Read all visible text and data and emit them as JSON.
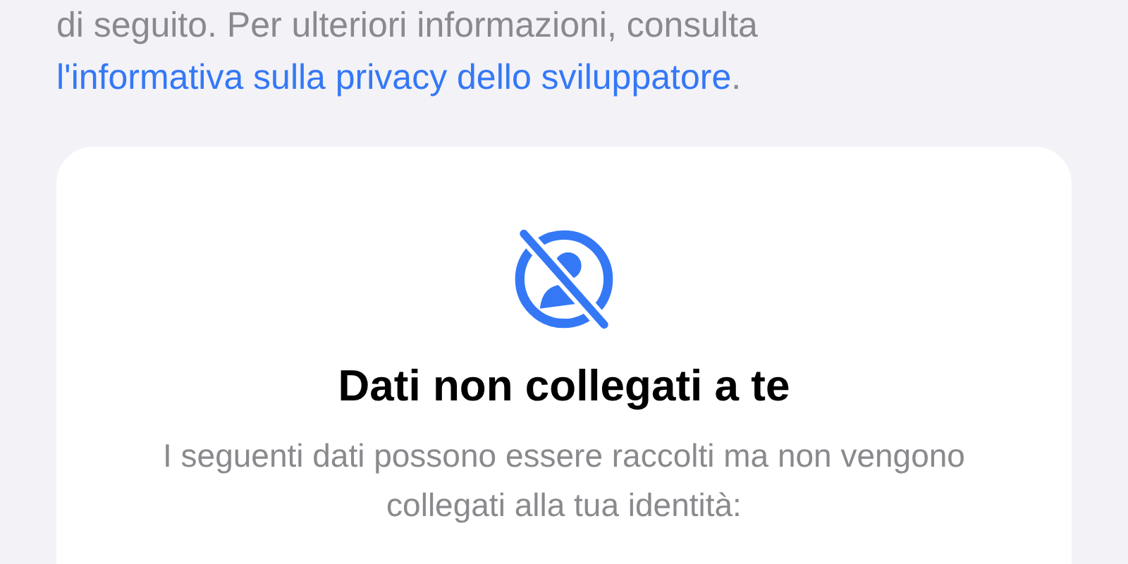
{
  "intro": {
    "text": "di seguito. Per ulteriori informazioni, consulta",
    "link": "l'informativa sulla privacy dello sviluppatore",
    "after": "."
  },
  "card": {
    "title": "Dati non collegati a te",
    "description": "I seguenti dati possono essere raccolti ma non vengono collegati alla tua identità:"
  }
}
